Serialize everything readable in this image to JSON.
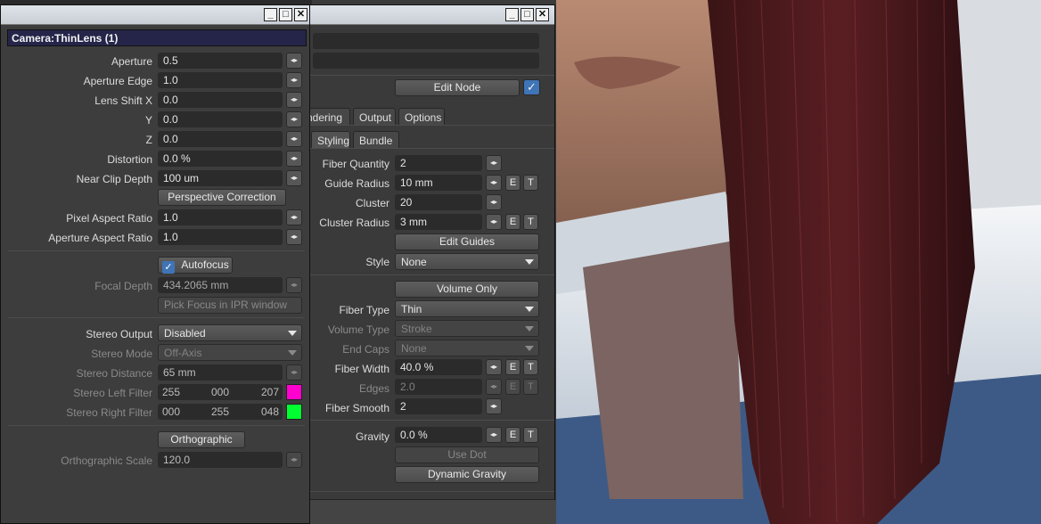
{
  "camera_panel": {
    "title": "Camera:ThinLens (1)",
    "rows": [
      {
        "label": "Aperture",
        "value": "0.5"
      },
      {
        "label": "Aperture Edge",
        "value": "1.0"
      },
      {
        "label": "Lens Shift X",
        "value": "0.0"
      },
      {
        "label": "Y",
        "value": "0.0"
      },
      {
        "label": "Z",
        "value": "0.0"
      },
      {
        "label": "Distortion",
        "value": "0.0 %"
      },
      {
        "label": "Near Clip Depth",
        "value": "100 um"
      }
    ],
    "perspective_correction": "Perspective Correction",
    "rows2": [
      {
        "label": "Pixel Aspect Ratio",
        "value": "1.0"
      },
      {
        "label": "Aperture Aspect Ratio",
        "value": "1.0"
      }
    ],
    "autofocus": "Autofocus",
    "focal_depth": {
      "label": "Focal Depth",
      "value": "434.2065 mm"
    },
    "pick_focus": "Pick Focus in IPR window",
    "stereo_output": {
      "label": "Stereo Output",
      "value": "Disabled"
    },
    "stereo_mode": {
      "label": "Stereo Mode",
      "value": "Off-Axis"
    },
    "stereo_distance": {
      "label": "Stereo Distance",
      "value": "65 mm"
    },
    "stereo_left": {
      "label": "Stereo Left Filter",
      "r": "255",
      "g": "000",
      "b": "207",
      "color": "#ff00cf"
    },
    "stereo_right": {
      "label": "Stereo Right Filter",
      "r": "000",
      "g": "255",
      "b": "048",
      "color": "#00ff30"
    },
    "orthographic": "Orthographic",
    "ortho_scale": {
      "label": "Orthographic Scale",
      "value": "120.0"
    }
  },
  "fiber_panel": {
    "edit_node": "Edit Node",
    "tabs_top": [
      "ndering",
      "Output",
      "Options"
    ],
    "tabs_sub": [
      "Styling",
      "Bundle"
    ],
    "fiber_quantity": {
      "label": "Fiber Quantity",
      "value": "2"
    },
    "guide_radius": {
      "label": "Guide Radius",
      "value": "10 mm"
    },
    "cluster": {
      "label": "Cluster",
      "value": "20"
    },
    "cluster_radius": {
      "label": "Cluster Radius",
      "value": "3 mm"
    },
    "edit_guides": "Edit Guides",
    "style": {
      "label": "Style",
      "value": "None"
    },
    "volume_only": "Volume Only",
    "fiber_type": {
      "label": "Fiber Type",
      "value": "Thin"
    },
    "volume_type": {
      "label": "Volume Type",
      "value": "Stroke"
    },
    "end_caps": {
      "label": "End Caps",
      "value": "None"
    },
    "fiber_width": {
      "label": "Fiber Width",
      "value": "40.0 %"
    },
    "edges": {
      "label": "Edges",
      "value": "2.0"
    },
    "fiber_smooth": {
      "label": "Fiber Smooth",
      "value": "2"
    },
    "gravity": {
      "label": "Gravity",
      "value": "0.0 %"
    },
    "use_dot": "Use Dot",
    "dynamic_gravity": "Dynamic Gravity",
    "e_label": "E",
    "t_label": "T"
  },
  "window_buttons": {
    "min": "_",
    "max": "□",
    "close": "✕"
  },
  "spin_glyph": "◂▸",
  "check_glyph": "✓"
}
